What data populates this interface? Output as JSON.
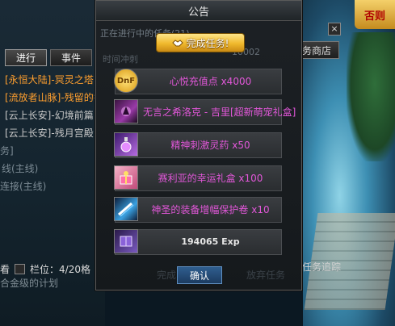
{
  "corner_badge": "否则",
  "quest_panel": {
    "tabs": [
      {
        "label": "进行",
        "active": true
      },
      {
        "label": "事件",
        "active": false
      }
    ],
    "quests": [
      {
        "text": "[永恒大陆]-冥灵之塔",
        "color": "#ff9f2e"
      },
      {
        "text": "[流放者山脉]-残留的香气",
        "color": "#ff9f2e"
      },
      {
        "text": "[云上长安]-幻境前篇",
        "color": "#c9c9c9"
      },
      {
        "text": "[云上长安]-残月宫殿",
        "color": "#c9c9c9"
      }
    ],
    "sub_items": [
      "务]",
      "线(主线)",
      "连接(主线)"
    ],
    "bottom_label": "看",
    "slot_label": "栏位：4/20格",
    "bottom_line2": "合金级的计划"
  },
  "right": {
    "close_symbol": "×",
    "shop_button": "任务商店",
    "track_button": "任务追踪"
  },
  "dialog": {
    "title": "公告",
    "subtitle": "正在进行中的任务(21)",
    "subtitle2": "时间冲刺",
    "number": "10002",
    "banner": "完成任务!",
    "rewards": [
      {
        "icon": "dnf-coin-icon",
        "icon_text": "DnF",
        "label": "心悦充值点 x4000",
        "color": "#e257d9"
      },
      {
        "icon": "pet-box-icon",
        "icon_text": "",
        "label": "无言之希洛克 - 吉里[超新萌宠礼盒]",
        "color": "#e257d9"
      },
      {
        "icon": "potion-icon",
        "icon_text": "",
        "label": "精神刺激灵药 x50",
        "color": "#e257d9"
      },
      {
        "icon": "gift-box-icon",
        "icon_text": "",
        "label": "赛利亚的幸运礼盒 x100",
        "color": "#e257d9"
      },
      {
        "icon": "scroll-icon",
        "icon_text": "",
        "label": "神圣的装备增幅保护卷 x10",
        "color": "#e257d9"
      },
      {
        "icon": "book-icon",
        "icon_text": "",
        "label": "194065 Exp",
        "color": "#e6e6e6"
      }
    ],
    "confirm_button": "确认",
    "faded_left": "完成",
    "faded_right": "放弃任务"
  }
}
